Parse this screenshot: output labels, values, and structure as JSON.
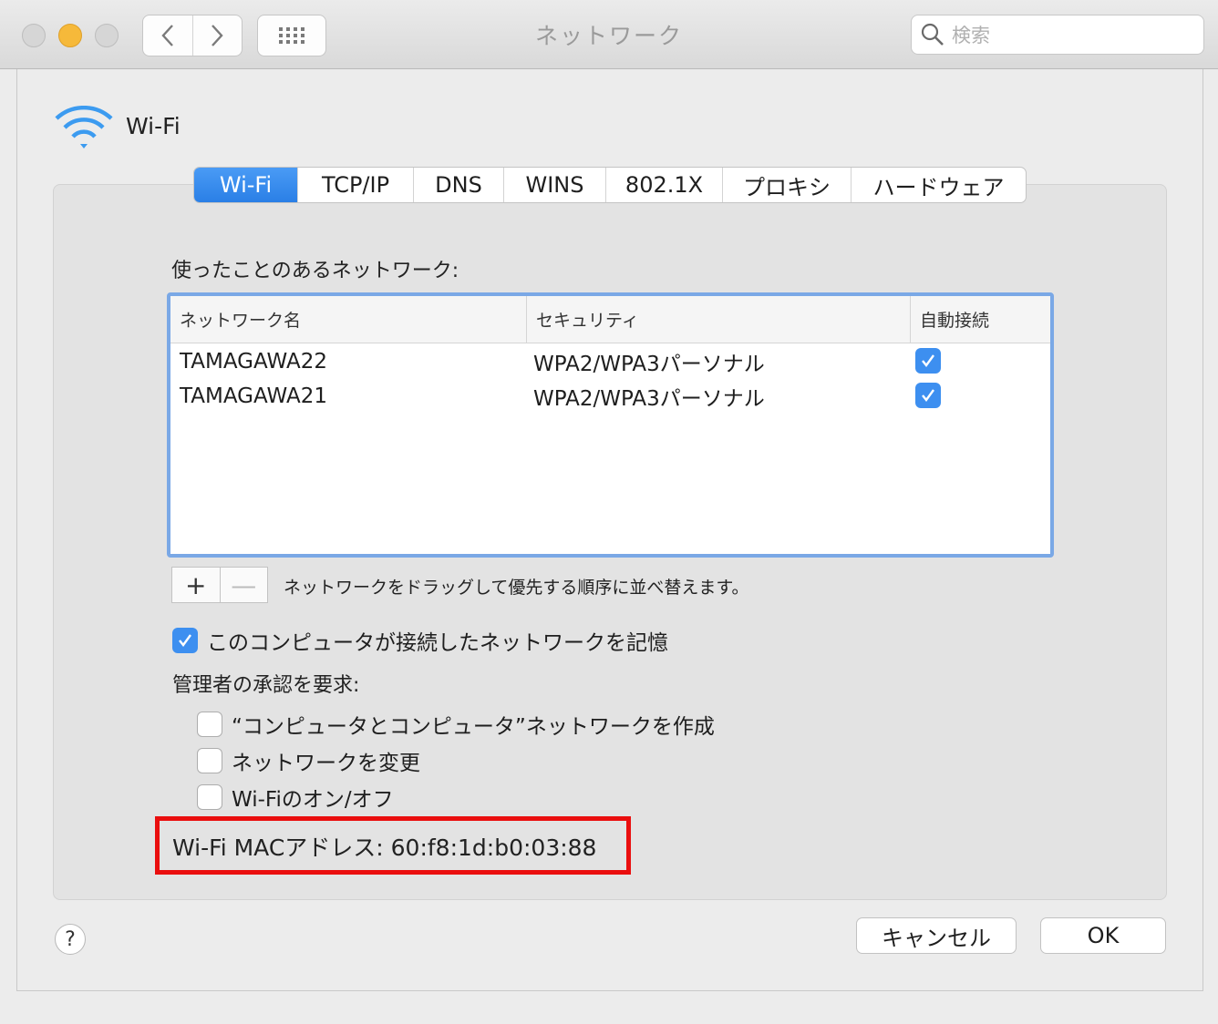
{
  "window": {
    "title": "ネットワーク"
  },
  "search": {
    "placeholder": "検索"
  },
  "header": {
    "title": "Wi-Fi"
  },
  "tabs": [
    {
      "label": "Wi-Fi",
      "active": true
    },
    {
      "label": "TCP/IP"
    },
    {
      "label": "DNS"
    },
    {
      "label": "WINS"
    },
    {
      "label": "802.1X"
    },
    {
      "label": "プロキシ"
    },
    {
      "label": "ハードウェア"
    }
  ],
  "networks": {
    "label": "使ったことのあるネットワーク:",
    "columns": [
      "ネットワーク名",
      "セキュリティ",
      "自動接続"
    ],
    "rows": [
      {
        "name": "TAMAGAWA22",
        "security": "WPA2/WPA3パーソナル",
        "auto_join": true
      },
      {
        "name": "TAMAGAWA21",
        "security": "WPA2/WPA3パーソナル",
        "auto_join": true
      }
    ],
    "add_label": "+",
    "remove_label": "—",
    "hint": "ネットワークをドラッグして優先する順序に並べ替えます。"
  },
  "remember": {
    "label": "このコンピュータが接続したネットワークを記憶",
    "checked": true
  },
  "admin": {
    "label": "管理者の承認を要求:",
    "options": [
      {
        "label": "“コンピュータとコンピュータ”ネットワークを作成",
        "checked": false
      },
      {
        "label": "ネットワークを変更",
        "checked": false
      },
      {
        "label": "Wi-Fiのオン/オフ",
        "checked": false
      }
    ]
  },
  "mac": {
    "text": "Wi-Fi MACアドレス:  60:f8:1d:b0:03:88"
  },
  "footer": {
    "help": "?",
    "cancel": "キャンセル",
    "ok": "OK"
  },
  "colors": {
    "accent": "#2a7fe6",
    "highlight": "#ea0e0e"
  }
}
